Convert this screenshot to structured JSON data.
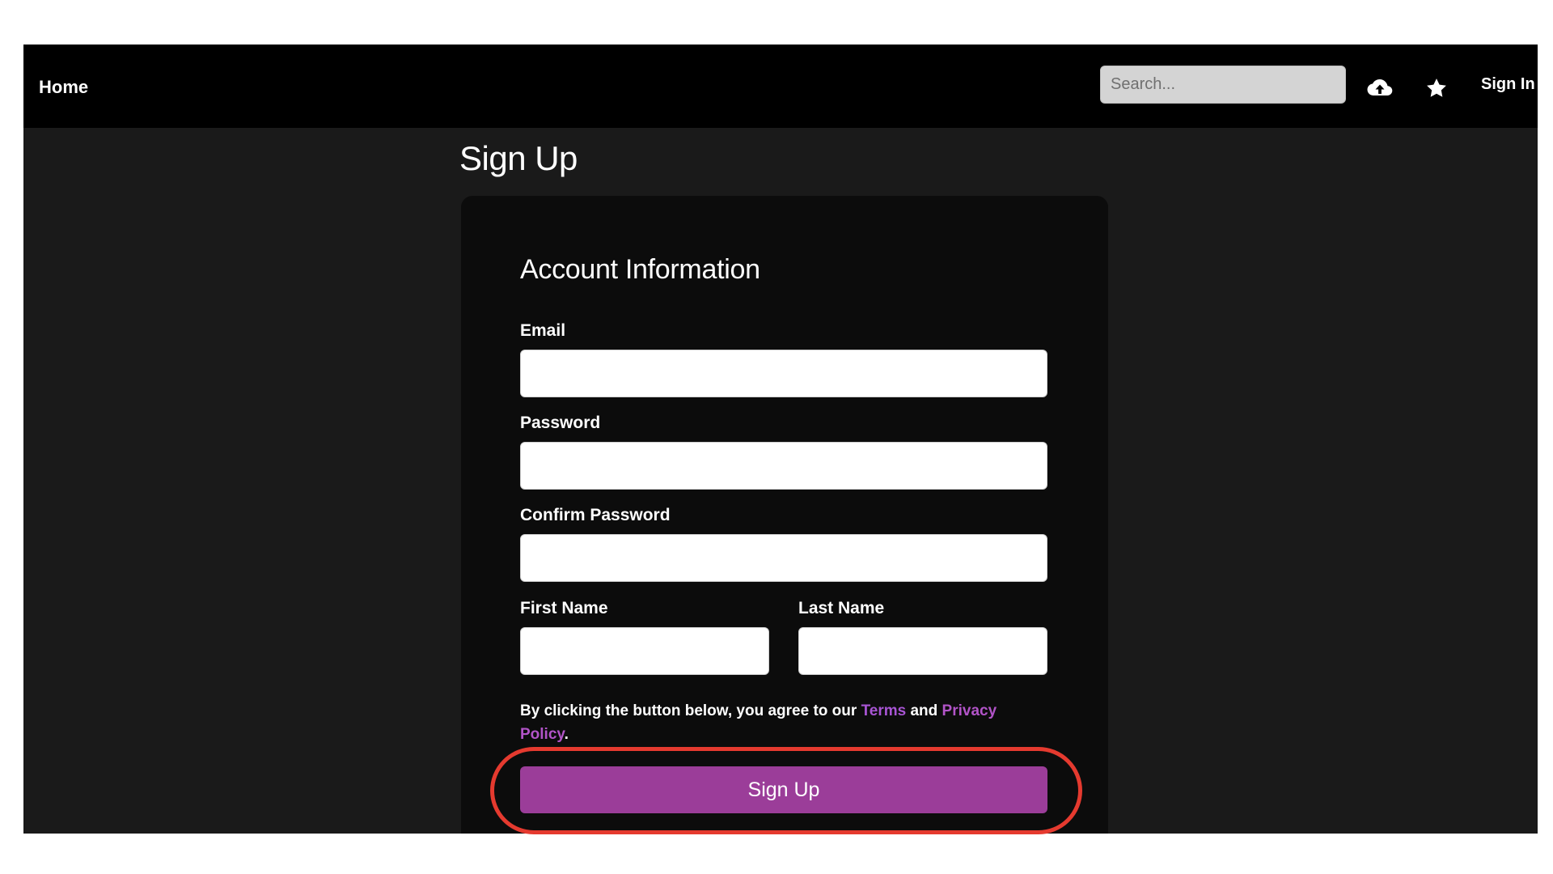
{
  "navbar": {
    "home_label": "Home",
    "search_placeholder": "Search...",
    "upload_icon": "cloud-upload-icon",
    "star_icon": "star-icon",
    "signin_label": "Sign In"
  },
  "page": {
    "title": "Sign Up"
  },
  "form": {
    "section_title": "Account Information",
    "email_label": "Email",
    "email_value": "",
    "password_label": "Password",
    "password_value": "",
    "confirm_password_label": "Confirm Password",
    "confirm_password_value": "",
    "first_name_label": "First Name",
    "first_name_value": "",
    "last_name_label": "Last Name",
    "last_name_value": "",
    "agreement_prefix": "By clicking the button below, you agree to our ",
    "terms_label": "Terms",
    "agreement_and": " and ",
    "privacy_label": "Privacy Policy",
    "agreement_suffix": ".",
    "submit_label": "Sign Up"
  },
  "colors": {
    "app_background": "#1a1a1a",
    "navbar_background": "#000000",
    "card_background": "#0c0c0c",
    "accent_button": "#9b3d99",
    "terms_link": "#a855d4",
    "privacy_link": "#b254c8",
    "highlight_ring": "#e53a2f"
  }
}
